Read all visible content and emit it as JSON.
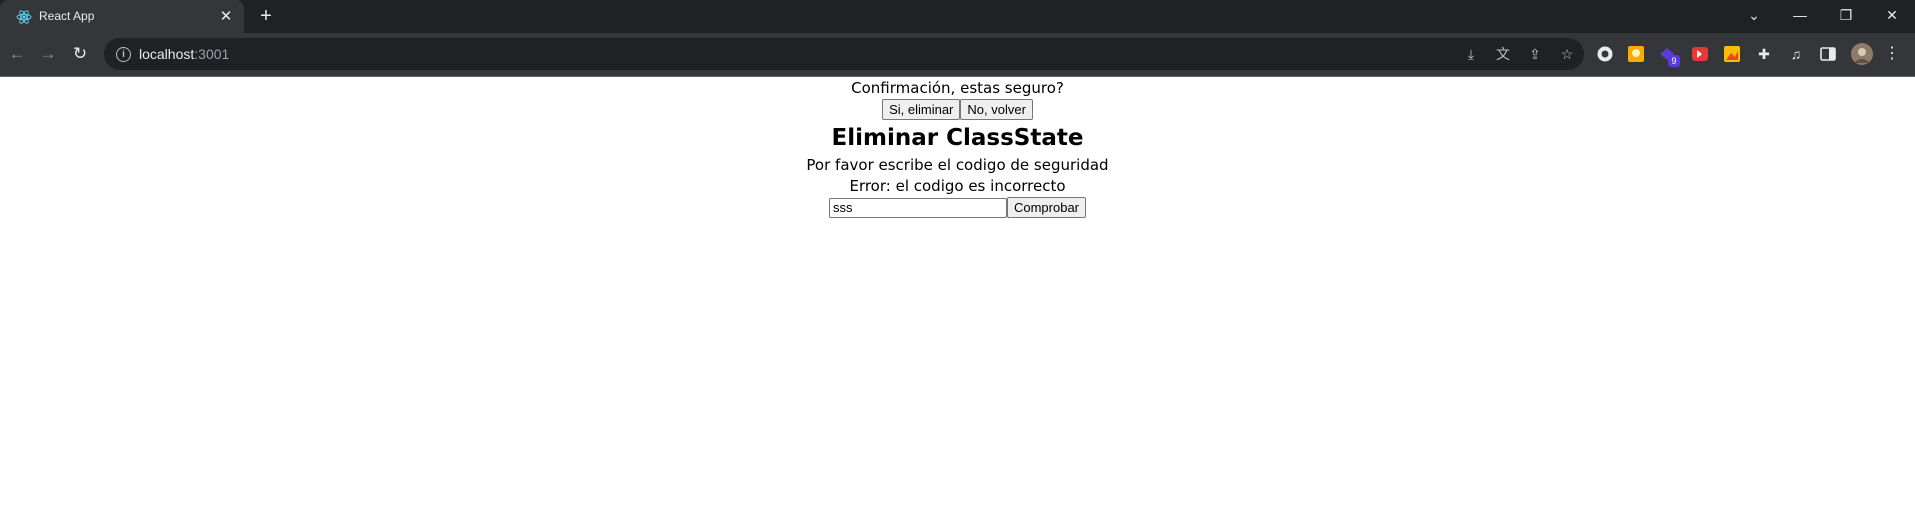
{
  "browser": {
    "tab_title": "React App",
    "url_host": "localhost",
    "url_port": ":3001"
  },
  "page": {
    "confirm_text": "Confirmación, estas seguro?",
    "confirm_yes": "Si, eliminar",
    "confirm_no": "No, volver",
    "title": "Eliminar ClassState",
    "instruction": "Por favor escribe el codigo de seguridad",
    "error": "Error: el codigo es incorrecto",
    "input_value": "sss",
    "check_button": "Comprobar"
  },
  "extensions": {
    "badge_count": "9"
  },
  "icons": {
    "tab": "react-icon",
    "close": "close-icon",
    "new_tab": "plus-icon",
    "back": "back-arrow-icon",
    "forward": "forward-arrow-icon",
    "reload": "reload-icon",
    "site_info": "info-icon",
    "install": "install-icon",
    "translate": "translate-icon",
    "share": "share-icon",
    "bookmark": "star-icon",
    "extensions": "puzzle-icon",
    "media": "media-icon",
    "side_panel": "side-panel-icon",
    "menu": "kebab-menu-icon"
  }
}
